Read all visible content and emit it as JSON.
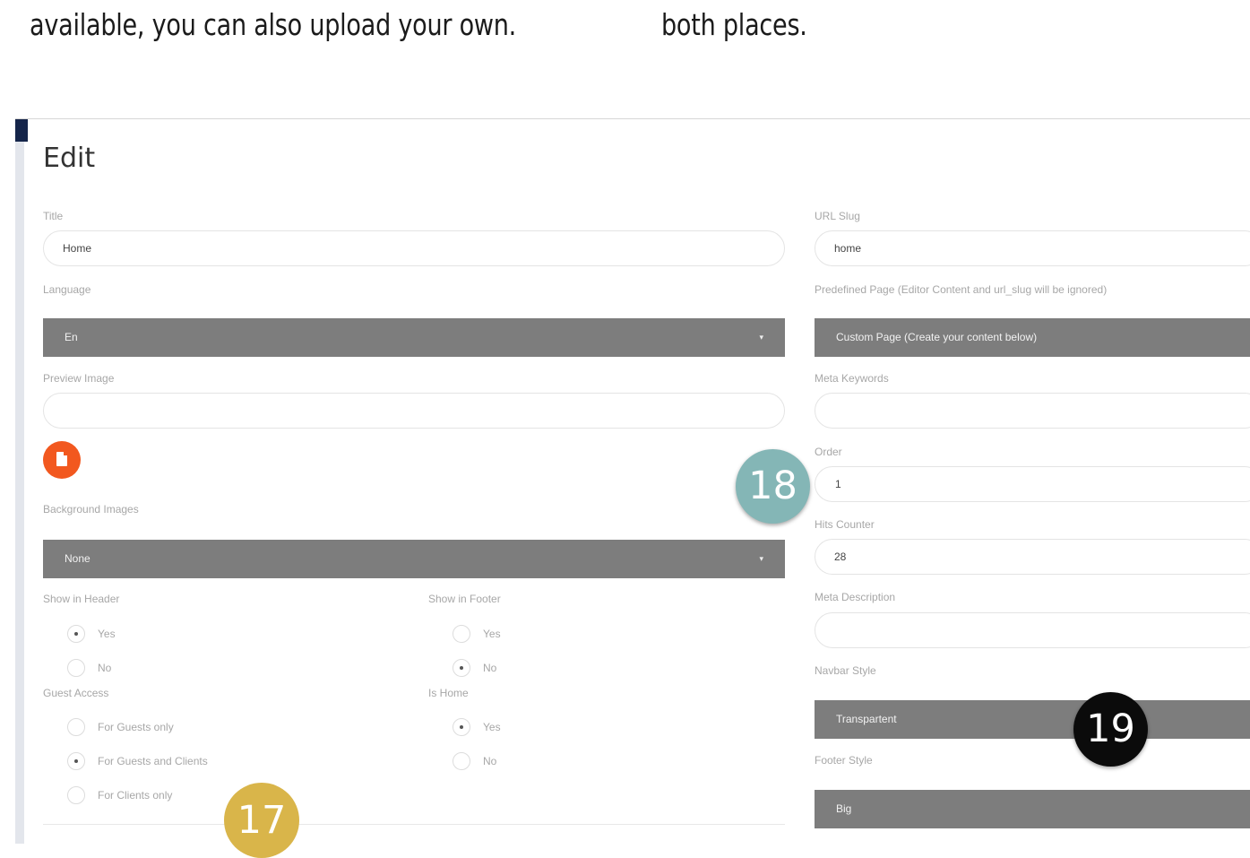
{
  "document": {
    "left_text": "available, you can also upload your own.",
    "right_text": "both places."
  },
  "edit": {
    "heading": "Edit",
    "title": {
      "label": "Title",
      "value": "Home"
    },
    "language": {
      "label": "Language",
      "value": "En"
    },
    "preview_image": {
      "label": "Preview Image",
      "value": ""
    },
    "background_images": {
      "label": "Background Images",
      "value": "None"
    },
    "show_in_header": {
      "label": "Show in Header",
      "options": [
        {
          "label": "Yes",
          "checked": true
        },
        {
          "label": "No",
          "checked": false
        }
      ]
    },
    "show_in_footer": {
      "label": "Show in Footer",
      "options": [
        {
          "label": "Yes",
          "checked": false
        },
        {
          "label": "No",
          "checked": true
        }
      ]
    },
    "guest_access": {
      "label": "Guest Access",
      "options": [
        {
          "label": "For Guests only",
          "checked": false
        },
        {
          "label": "For Guests and Clients",
          "checked": true
        },
        {
          "label": "For Clients only",
          "checked": false
        }
      ]
    },
    "is_home": {
      "label": "Is Home",
      "options": [
        {
          "label": "Yes",
          "checked": true
        },
        {
          "label": "No",
          "checked": false
        }
      ]
    },
    "url_slug": {
      "label": "URL Slug",
      "value": "home"
    },
    "predefined_page": {
      "label": "Predefined Page (Editor Content and url_slug will be ignored)",
      "value": "Custom Page (Create your content below)"
    },
    "meta_keywords": {
      "label": "Meta Keywords",
      "value": ""
    },
    "order": {
      "label": "Order",
      "value": "1"
    },
    "hits_counter": {
      "label": "Hits Counter",
      "value": "28"
    },
    "meta_description": {
      "label": "Meta Description",
      "value": ""
    },
    "navbar_style": {
      "label": "Navbar Style",
      "value": "Transpartent"
    },
    "footer_style": {
      "label": "Footer Style",
      "value": "Big"
    }
  },
  "callouts": {
    "badge_17": "17",
    "badge_18": "18",
    "badge_19": "19"
  },
  "colors": {
    "badge_17": "#d9b54a",
    "badge_18": "#84b6b6",
    "badge_19": "#0b0b0b",
    "upload_button": "#f2581f",
    "select_bg": "#7d7d7d"
  },
  "icons": {
    "upload": "file-icon",
    "select_caret": "caret-down-icon"
  }
}
